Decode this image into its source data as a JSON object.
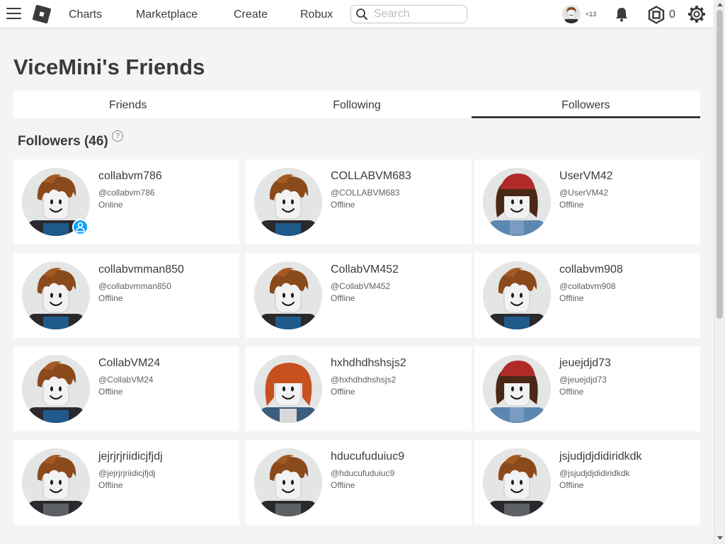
{
  "topbar": {
    "nav": [
      "Charts",
      "Marketplace",
      "Create",
      "Robux"
    ],
    "search_placeholder": "Search",
    "age_label": "<13",
    "robux_count": "0"
  },
  "page_title": "ViceMini's Friends",
  "tabs": [
    {
      "label": "Friends",
      "active": false
    },
    {
      "label": "Following",
      "active": false
    },
    {
      "label": "Followers",
      "active": true
    }
  ],
  "section_title": "Followers (46)",
  "help_label": "?",
  "colors": {
    "accent": "#393b3d",
    "online": "#00a2ff",
    "background": "#f2f4f5"
  },
  "followers": [
    {
      "name": "collabvm786",
      "handle": "@collabvm786",
      "status": "Online",
      "avatar": "bacon-blue"
    },
    {
      "name": "COLLABVM683",
      "handle": "@COLLABVM683",
      "status": "Offline",
      "avatar": "bacon-blue"
    },
    {
      "name": "UserVM42",
      "handle": "@UserVM42",
      "status": "Offline",
      "avatar": "brown-hat-denim"
    },
    {
      "name": "collabvmman850",
      "handle": "@collabvmman850",
      "status": "Offline",
      "avatar": "bacon-blue"
    },
    {
      "name": "CollabVM452",
      "handle": "@CollabVM452",
      "status": "Offline",
      "avatar": "bacon-blue"
    },
    {
      "name": "collabvm908",
      "handle": "@collabvm908",
      "status": "Offline",
      "avatar": "bacon-blue"
    },
    {
      "name": "CollabVM24",
      "handle": "@CollabVM24",
      "status": "Offline",
      "avatar": "bacon-blue"
    },
    {
      "name": "hxhdhdhshsjs2",
      "handle": "@hxhdhdhshsjs2",
      "status": "Offline",
      "avatar": "redhead-jacket"
    },
    {
      "name": "jeuejdjd73",
      "handle": "@jeuejdjd73",
      "status": "Offline",
      "avatar": "brown-hat-denim"
    },
    {
      "name": "jejrjrjriidicjfjdj",
      "handle": "@jejrjrjriidicjfjdj",
      "status": "Offline",
      "avatar": "bacon-gray"
    },
    {
      "name": "hducufuduiuc9",
      "handle": "@hducufuduiuc9",
      "status": "Offline",
      "avatar": "bacon-gray"
    },
    {
      "name": "jsjudjdjdidiridkdk",
      "handle": "@jsjudjdjdidiridkdk",
      "status": "Offline",
      "avatar": "bacon-gray"
    }
  ]
}
